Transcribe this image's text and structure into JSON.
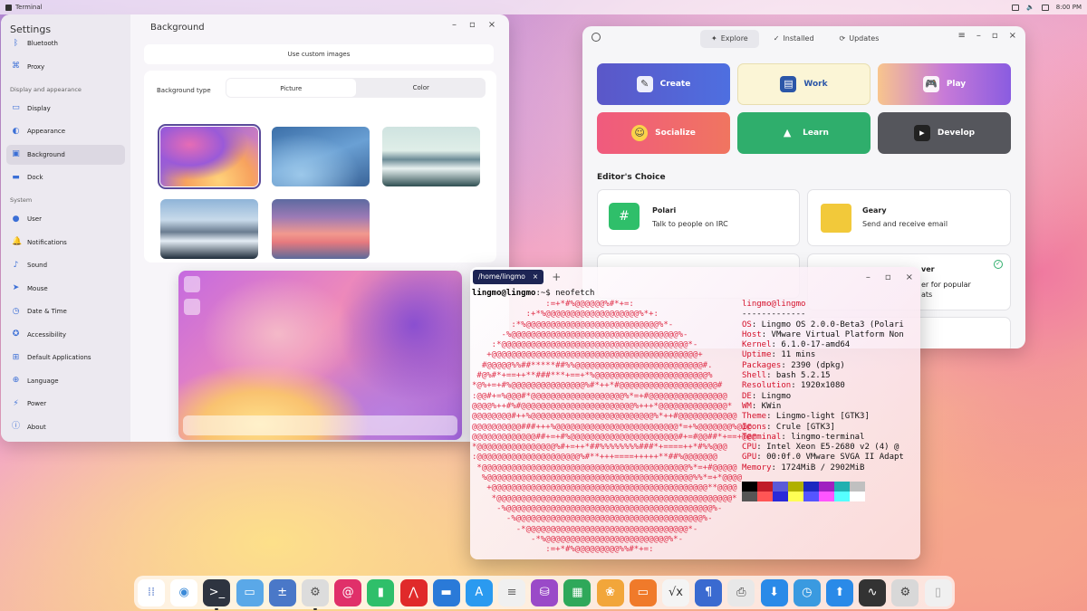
{
  "topbar": {
    "app": "Terminal",
    "time": "8:00 PM"
  },
  "settings": {
    "title": "Settings",
    "window_title": "Background",
    "custom_images": "Use custom images",
    "bg_type_label": "Background type",
    "seg_picture": "Picture",
    "seg_color": "Color",
    "sections": {
      "display": "Display and appearance",
      "system": "System"
    },
    "items": [
      "Bluetooth",
      "Proxy",
      "Display",
      "Appearance",
      "Background",
      "Dock",
      "User",
      "Notifications",
      "Sound",
      "Mouse",
      "Date & Time",
      "Accessibility",
      "Default Applications",
      "Language",
      "Power",
      "About"
    ]
  },
  "store": {
    "tabs": [
      "Explore",
      "Installed",
      "Updates"
    ],
    "tiles": [
      "Create",
      "Work",
      "Play",
      "Socialize",
      "Learn",
      "Develop"
    ],
    "editors_choice": "Editor's Choice",
    "apps": [
      {
        "name": "Polari",
        "desc": "Talk to people on IRC"
      },
      {
        "name": "Geary",
        "desc": "Send and receive email"
      },
      {
        "name": "ver",
        "desc": "er for popular"
      },
      {
        "name": "",
        "desc": "ats"
      }
    ]
  },
  "terminal": {
    "tab": "/home/lingmo",
    "prompt_user": "lingmo@lingmo",
    "prompt_rest": ":~$ neofetch",
    "header": "lingmo@lingmo",
    "sep": "-------------",
    "info": [
      {
        "k": "OS",
        "v": ": Lingmo OS 2.0.0-Beta3 (Polari"
      },
      {
        "k": "Host",
        "v": ": VMware Virtual Platform Non"
      },
      {
        "k": "Kernel",
        "v": ": 6.1.0-17-amd64"
      },
      {
        "k": "Uptime",
        "v": ": 11 mins"
      },
      {
        "k": "Packages",
        "v": ": 2390 (dpkg)"
      },
      {
        "k": "Shell",
        "v": ": bash 5.2.15"
      },
      {
        "k": "Resolution",
        "v": ": 1920x1080"
      },
      {
        "k": "DE",
        "v": ": Lingmo"
      },
      {
        "k": "WM",
        "v": ": KWin"
      },
      {
        "k": "Theme",
        "v": ": Lingmo-light [GTK3]"
      },
      {
        "k": "Icons",
        "v": ": Crule [GTK3]"
      },
      {
        "k": "Terminal",
        "v": ": lingmo-terminal"
      },
      {
        "k": "CPU",
        "v": ": Intel Xeon E5-2680 v2 (4) @"
      },
      {
        "k": "GPU",
        "v": ": 00:0f.0 VMware SVGA II Adapt"
      },
      {
        "k": "Memory",
        "v": ": 1724MiB / 2902MiB"
      }
    ],
    "art": [
      "               :=+*#%@@@@@@%#*+=:",
      "           :+*%@@@@@@@@@@@@@@@@@@@%*+:",
      "        :*%@@@@@@@@@@@@@@@@@@@@@@@@@@@%*-",
      "      -%@@@@@@@@@@@@@@@@@@@@@@@@@@@@@@@@@@%-",
      "    :*@@@@@@@@@@@@@@@@@@@@@@@@@@@@@@@@@@@@@@*-",
      "   +@@@@@@@@@@@@@@@@@@@@@@@@@@@@@@@@@@@@@@@@@@+",
      "  #@@@@@%%##*****##%%@@@@@@@@@@@@@@@@@@@@@@@@@@#.",
      " #@%#*+==++**###***+==+*%@@@@@@@@@@@@@@@@@@@@@@@%",
      "*@%+=+#%@@@@@@@@@@@@@@@%#*++*#@@@@@@@@@@@@@@@@@@@@#",
      ":@@#+=%@@@#*@@@@@@@@@@@@@@@@@@@%*=+#@@@@@@@@@@@@@@@@",
      "@@@@%++#%#@@@@@@@@@@@@@@@@@@@@@@@%+++*@@@@@@@@@@@@@@*",
      "@@@@@@@@#++%@@@@@@@@@@@@@@@@@@@@@@@@@%*++#@@@@@@@@@@@@",
      "@@@@@@@@@@###+++%@@@@@@@@@@@@@@@@@@@@@@@@@*=+%@@@@@@@%@@@",
      "@@@@@@@@@@@@@##+=+#%@@@@@@@@@@@@@@@@@@@@@@#+=#@@##*+==+@@@",
      "*@@@@@@@@@@@@@@@@%#+=++*##%%%%%%%%###*+====++*#%%@@@",
      ":@@@@@@@@@@@@@@@@@@@@@%#**+++====+++++**##%@@@@@@@",
      " *@@@@@@@@@@@@@@@@@@@@@@@@@@@@@@@@@@@@@@@@@@%*=+#@@@@@",
      "  %@@@@@@@@@@@@@@@@@@@@@@@@@@@@@@@@@@@@@@@@@@%%*=+*@@@@",
      "   +@@@@@@@@@@@@@@@@@@@@@@@@@@@@@@@@@@@@@@@@@@@@**@@@@",
      "    *@@@@@@@@@@@@@@@@@@@@@@@@@@@@@@@@@@@@@@@@@@@@@@@@*",
      "     -%@@@@@@@@@@@@@@@@@@@@@@@@@@@@@@@@@@@@@@@@@@%-",
      "       -%@@@@@@@@@@@@@@@@@@@@@@@@@@@@@@@@@@@@@@%-",
      "         -*@@@@@@@@@@@@@@@@@@@@@@@@@@@@@@@@@*-",
      "            -*%@@@@@@@@@@@@@@@@@@@@@@@@@%*-",
      "               :=+*#%@@@@@@@@@%%#*+=:"
    ]
  },
  "colors": {
    "accent": "#3b6fd6",
    "terminal_red": "#e0304a",
    "term_tab": "#1d2554"
  },
  "dock": [
    "launcher-icon",
    "chromium-icon",
    "terminal-icon",
    "files-icon",
    "calculator-icon",
    "settings-icon",
    "debian-icon",
    "android-icon",
    "pdf-icon",
    "finder-icon",
    "appstore-icon",
    "notes-icon",
    "database-icon",
    "spreadsheet-icon",
    "photos-icon",
    "presentation-icon",
    "tex-icon",
    "writer-icon",
    "printer-icon",
    "downloads-icon",
    "system-monitor-icon",
    "updates-icon",
    "activity-icon",
    "gear-icon",
    "trash-icon"
  ]
}
